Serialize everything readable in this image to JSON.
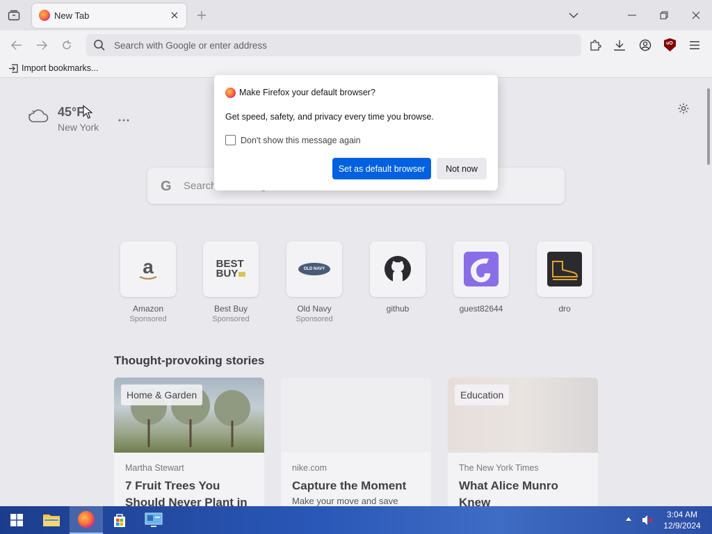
{
  "browser": {
    "tab": {
      "title": "New Tab"
    },
    "url_placeholder": "Search with Google or enter address",
    "bookmarks": {
      "import_label": "Import bookmarks..."
    }
  },
  "weather": {
    "temperature": "45°F",
    "city": "New York"
  },
  "search": {
    "placeholder": "Search with Google or enter address"
  },
  "top_sites": [
    {
      "label": "Amazon",
      "sponsored": "Sponsored"
    },
    {
      "label": "Best Buy",
      "sponsored": "Sponsored"
    },
    {
      "label": "Old Navy",
      "sponsored": "Sponsored"
    },
    {
      "label": "github",
      "sponsored": ""
    },
    {
      "label": "guest82644",
      "sponsored": ""
    },
    {
      "label": "dro",
      "sponsored": ""
    }
  ],
  "tile_logos": {
    "bestbuy_line1": "BEST",
    "bestbuy_line2": "BUY",
    "oldnavy": "OLD NAVY"
  },
  "stories": {
    "title": "Thought-provoking stories",
    "cards": [
      {
        "badge": "Home & Garden",
        "source": "Martha Stewart",
        "headline": "7 Fruit Trees You Should Never Plant in",
        "sub": ""
      },
      {
        "badge": "",
        "source": "nike.com",
        "headline": "Capture the Moment",
        "sub": "Make your move and save"
      },
      {
        "badge": "Education",
        "source": "The New York Times",
        "headline": "What Alice Munro Knew",
        "sub": ""
      }
    ]
  },
  "dialog": {
    "title": "Make Firefox your default browser?",
    "body": "Get speed, safety, and privacy every time you browse.",
    "checkbox_label": "Don't show this message again",
    "checkbox_checked": false,
    "primary_button": "Set as default browser",
    "secondary_button": "Not now"
  },
  "taskbar": {
    "time": "3:04 AM",
    "date": "12/9/2024"
  },
  "colors": {
    "accent": "#0061e0",
    "ublock": "#800000"
  }
}
